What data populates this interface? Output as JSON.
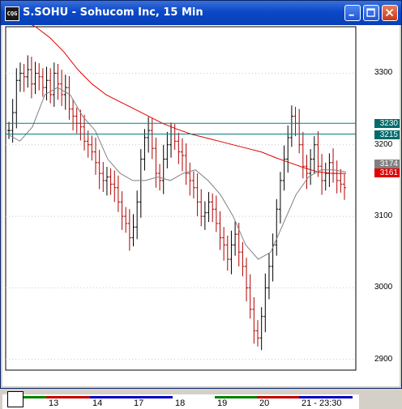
{
  "window": {
    "title": "S.SOHU - Sohucom Inc, 15 Min",
    "icon_label": "CQG"
  },
  "title_buttons": [
    "minimize",
    "maximize",
    "close"
  ],
  "colors": {
    "up_bar": "#000000",
    "down_bar": "#b00000",
    "ma_long": "#e00000",
    "ma_short": "#808080",
    "hline": "#008080",
    "tag_teal": "#006b6b",
    "tag_gray": "#808080",
    "tag_red": "#e00000"
  },
  "price_tags": [
    {
      "label": "3230",
      "price": 3230,
      "color": "#006b6b"
    },
    {
      "label": "3215",
      "price": 3215,
      "color": "#006b6b"
    },
    {
      "label": "3174",
      "price": 3174,
      "color": "#808080"
    },
    {
      "label": "3161",
      "price": 3161,
      "color": "#e00000"
    }
  ],
  "date_labels": [
    {
      "label": "13",
      "strip": "#c00000"
    },
    {
      "label": "14",
      "strip": "#0000c0"
    },
    {
      "label": "17",
      "strip": "#0000c0"
    },
    {
      "label": "18",
      "strip": "#ffffff"
    },
    {
      "label": "19",
      "strip": "#008000"
    },
    {
      "label": "20",
      "strip": "#c00000"
    },
    {
      "label": "21 - 23:30",
      "strip": "#0000c0"
    }
  ],
  "chart_data": {
    "type": "ohlc",
    "title": "S.SOHU - Sohucom Inc, 15 Min",
    "y_ticks": [
      2900,
      3000,
      3100,
      3200,
      3300
    ],
    "ylim": [
      2885,
      3365
    ],
    "horizontal_lines": [
      3230,
      3215
    ],
    "close_path": [
      3220,
      3245,
      3290,
      3300,
      3295,
      3305,
      3285,
      3300,
      3295,
      3280,
      3290,
      3270,
      3300,
      3285,
      3270,
      3280,
      3250,
      3240,
      3230,
      3225,
      3205,
      3200,
      3190,
      3175,
      3160,
      3150,
      3155,
      3145,
      3140,
      3120,
      3100,
      3090,
      3070,
      3085,
      3120,
      3180,
      3210,
      3220,
      3195,
      3160,
      3150,
      3180,
      3200,
      3215,
      3205,
      3190,
      3185,
      3160,
      3150,
      3140,
      3120,
      3100,
      3105,
      3120,
      3110,
      3090,
      3070,
      3060,
      3040,
      3060,
      3075,
      3050,
      3030,
      3000,
      2970,
      2940,
      2930,
      2960,
      3000,
      3030,
      3060,
      3110,
      3150,
      3180,
      3210,
      3240,
      3230,
      3200,
      3170,
      3160,
      3180,
      3200,
      3170,
      3150,
      3160,
      3175,
      3160,
      3150,
      3145,
      3140
    ],
    "ma_long": [
      3380,
      3375,
      3365,
      3350,
      3330,
      3305,
      3285,
      3270,
      3260,
      3250,
      3240,
      3230,
      3222,
      3215,
      3210,
      3205,
      3200,
      3195,
      3190,
      3182,
      3175,
      3168,
      3162,
      3160,
      3160
    ],
    "ma_short": [
      3215,
      3205,
      3225,
      3270,
      3280,
      3270,
      3240,
      3220,
      3180,
      3160,
      3150,
      3150,
      3155,
      3150,
      3160,
      3165,
      3150,
      3130,
      3100,
      3060,
      3040,
      3050,
      3090,
      3130,
      3155,
      3165,
      3165,
      3162
    ]
  }
}
